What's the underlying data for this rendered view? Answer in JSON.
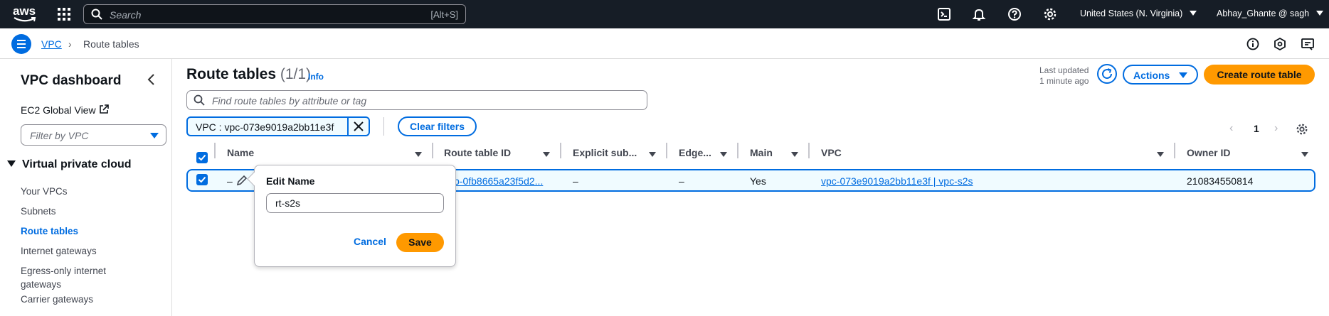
{
  "topbar": {
    "logo": "aws",
    "search_placeholder": "Search",
    "search_shortcut": "[Alt+S]",
    "region": "United States (N. Virginia)",
    "user": "Abhay_Ghante @ sagh"
  },
  "breadcrumb": {
    "service": "VPC",
    "current": "Route tables"
  },
  "sidebar": {
    "title": "VPC dashboard",
    "ec2_global_view": "EC2 Global View",
    "filter_placeholder": "Filter by VPC",
    "section": "Virtual private cloud",
    "items": [
      {
        "label": "Your VPCs"
      },
      {
        "label": "Subnets"
      },
      {
        "label": "Route tables"
      },
      {
        "label": "Internet gateways"
      },
      {
        "label": "Egress-only internet gateways"
      },
      {
        "label": "Carrier gateways"
      }
    ]
  },
  "main": {
    "title": "Route tables",
    "count": "(1/1)",
    "info": "Info",
    "last_updated_line1": "Last updated",
    "last_updated_line2": "1 minute ago",
    "actions_label": "Actions",
    "create_label": "Create route table",
    "find_placeholder": "Find route tables by attribute or tag",
    "filter_token": "VPC : vpc-073e9019a2bb11e3f",
    "clear_filters": "Clear filters",
    "page_number": "1"
  },
  "table": {
    "headers": [
      "Name",
      "Route table ID",
      "Explicit sub...",
      "Edge...",
      "Main",
      "VPC",
      "Owner ID"
    ],
    "row": {
      "name": "–",
      "route_table_id": "b-0fb8665a23f5d2...",
      "explicit_subnet": "–",
      "edge": "–",
      "main": "Yes",
      "vpc": "vpc-073e9019a2bb11e3f | vpc-s2s",
      "owner_id": "210834550814"
    }
  },
  "edit_popover": {
    "title": "Edit Name",
    "value": "rt-s2s",
    "cancel": "Cancel",
    "save": "Save"
  },
  "colors": {
    "topbar": "#161d26",
    "accent": "#006ce0",
    "primary_button": "#ff9900"
  }
}
